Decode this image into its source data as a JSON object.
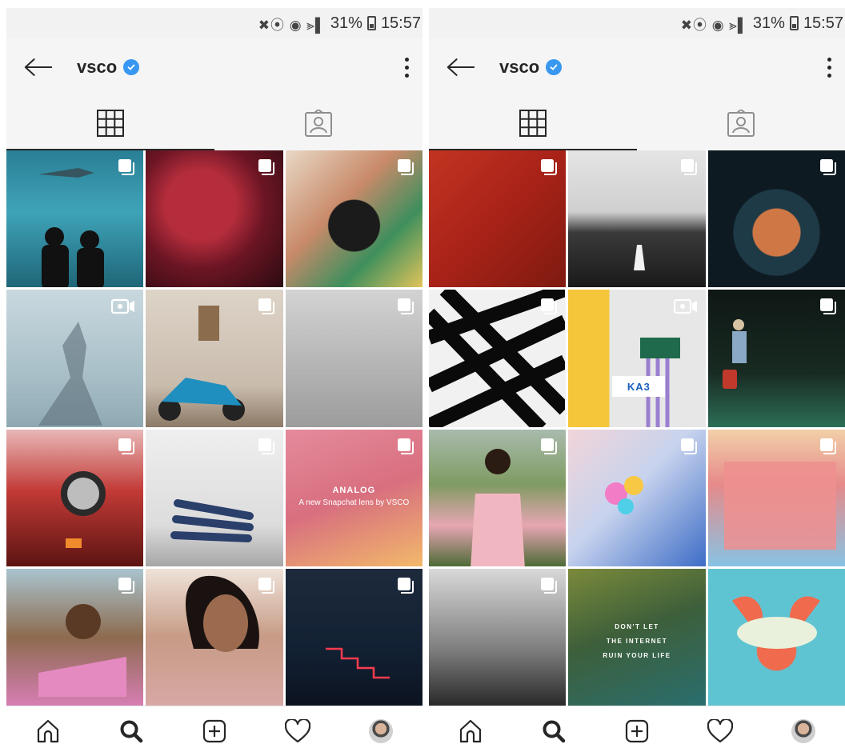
{
  "status": {
    "icons": "✖⦿ ◉ ⪢▌",
    "battery": "31%",
    "time": "15:57"
  },
  "header": {
    "account_name": "vsco",
    "verified_color": "#3897f0"
  },
  "tabs": [
    {
      "name": "grid",
      "icon": "grid-icon"
    },
    {
      "name": "tagged",
      "icon": "tagged-icon"
    }
  ],
  "left_grid": [
    {
      "photo": "aquarium-shark",
      "badge": "multi"
    },
    {
      "photo": "red-leaves",
      "badge": "multi"
    },
    {
      "photo": "colorful-dancer",
      "badge": "multi"
    },
    {
      "photo": "shadow-on-pavement",
      "badge": "video"
    },
    {
      "photo": "blue-scooter",
      "badge": "multi"
    },
    {
      "photo": "grey-landscape",
      "badge": "multi"
    },
    {
      "photo": "red-car-headlight",
      "badge": "multi"
    },
    {
      "photo": "white-wall-stretch",
      "badge": "multi"
    },
    {
      "photo": "analog-snapchat-lens",
      "badge": "multi",
      "title": "ANALOG",
      "subtitle": "A new Snapchat lens by VSCO"
    },
    {
      "photo": "child-portrait",
      "badge": "multi"
    },
    {
      "photo": "woman-flowers",
      "badge": "multi"
    },
    {
      "photo": "neon-stairs",
      "badge": "multi"
    }
  ],
  "right_grid": [
    {
      "photo": "red-paper-texture",
      "badge": "multi"
    },
    {
      "photo": "bw-field-figure",
      "badge": "multi"
    },
    {
      "photo": "dome-circle",
      "badge": "multi"
    },
    {
      "photo": "bw-criss-cross",
      "badge": "multi"
    },
    {
      "photo": "yellow-broom",
      "badge": "video",
      "tag": "KA3"
    },
    {
      "photo": "traveler-suitcase",
      "badge": "multi"
    },
    {
      "photo": "girl-pink-dress",
      "badge": "multi"
    },
    {
      "photo": "sky-collage",
      "badge": "multi"
    },
    {
      "photo": "pink-building",
      "badge": "multi"
    },
    {
      "photo": "bw-building-man",
      "badge": "multi"
    },
    {
      "photo": "dont-let-internet",
      "badge": "none",
      "text": "DON'T LET\nTHE INTERNET\nRUIN YOUR LIFE"
    },
    {
      "photo": "flower-crown",
      "badge": "none"
    }
  ],
  "nav": [
    {
      "name": "home",
      "icon": "home-icon"
    },
    {
      "name": "search",
      "icon": "search-icon"
    },
    {
      "name": "add",
      "icon": "add-post-icon"
    },
    {
      "name": "activity",
      "icon": "heart-icon"
    },
    {
      "name": "profile",
      "icon": "profile-avatar"
    }
  ]
}
